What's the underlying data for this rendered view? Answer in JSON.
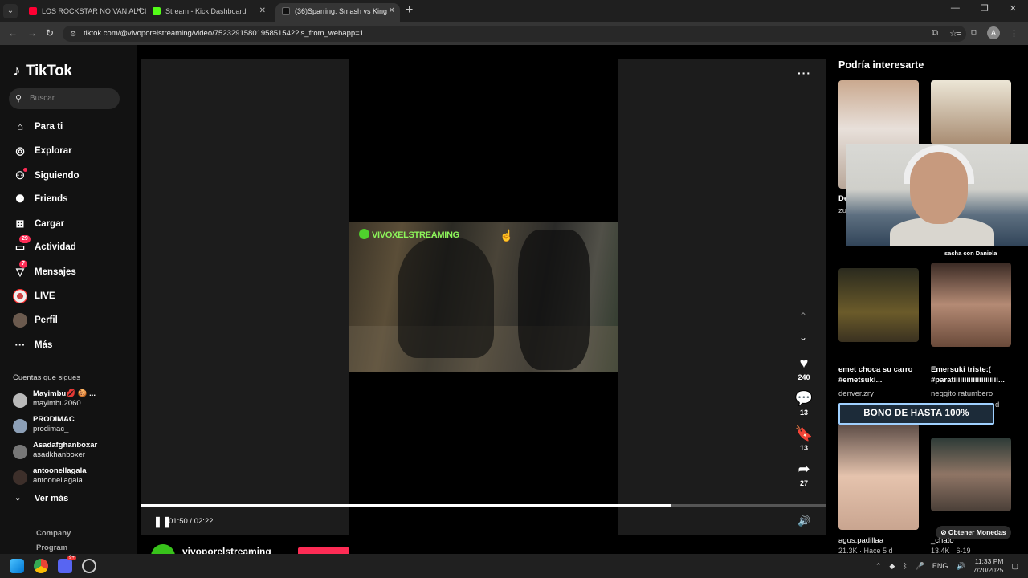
{
  "browser": {
    "tabs": [
      {
        "title": "LOS ROCKSTAR NO VAN AL CIE",
        "favicon_color": "#ff0033",
        "active": false
      },
      {
        "title": "Stream - Kick Dashboard",
        "favicon_color": "#53fc18",
        "active": false
      },
      {
        "title": "(36)Sparring: Smash vs King",
        "favicon_color": "#111111",
        "active": true
      }
    ],
    "url": "tiktok.com/@vivoporelstreaming/video/7523291580195851542?is_from_webapp=1",
    "profile_initial": "A"
  },
  "sidebar": {
    "logo": "TikTok",
    "search_placeholder": "Buscar",
    "nav": [
      {
        "label": "Para ti",
        "icon": "home-icon",
        "glyph": "⌂"
      },
      {
        "label": "Explorar",
        "icon": "compass-icon",
        "glyph": "⊘"
      },
      {
        "label": "Siguiendo",
        "icon": "following-icon",
        "glyph": "⚇"
      },
      {
        "label": "Friends",
        "icon": "friends-icon",
        "glyph": "⚉"
      },
      {
        "label": "Cargar",
        "icon": "upload-icon",
        "glyph": "⊞"
      },
      {
        "label": "Actividad",
        "icon": "activity-icon",
        "glyph": "▭",
        "badge": "29"
      },
      {
        "label": "Mensajes",
        "icon": "messages-icon",
        "glyph": "▽",
        "badge": "7"
      },
      {
        "label": "LIVE",
        "icon": "live-icon",
        "glyph": ""
      },
      {
        "label": "Perfil",
        "icon": "profile-icon",
        "glyph": ""
      },
      {
        "label": "Más",
        "icon": "more-icon",
        "glyph": "···"
      }
    ],
    "following_title": "Cuentas que sigues",
    "following": [
      {
        "name": "Mayimbu💋 🍪 ...",
        "handle": "mayimbu2060"
      },
      {
        "name": "PRODIMAC",
        "handle": "prodimac_"
      },
      {
        "name": "Asadafghanboxar",
        "handle": "asadkhanboxer"
      },
      {
        "name": "antoonellagala",
        "handle": "antoonellagala"
      }
    ],
    "see_more": "Ver más",
    "footer": [
      "Company",
      "Program"
    ]
  },
  "video": {
    "watermark": "VIVOXELSTREAMING",
    "time": "01:50 / 02:22",
    "progress": 0.7746,
    "author": "vivoporelstreaming",
    "likes": "240",
    "comments": "13",
    "saves": "13",
    "shares": "27"
  },
  "suggestions": {
    "title": "Podría interesarte",
    "items": [
      {
        "caption": "emet choca su carro #emetsuki...",
        "user": "denver.zry"
      },
      {
        "caption": "Emersuki triste:( #paratiiiiiiiiiiiiiiiiiiiii...",
        "user": "neggito.ratumbero"
      },
      {
        "user": "agus.padillaa",
        "meta": "21.3K · Hace 5 d"
      },
      {
        "user": "_chato",
        "meta": "13.4K · 6-19"
      }
    ],
    "partial_1": "De",
    "partial_2": "zu",
    "partial_3": "d"
  },
  "overlays": {
    "cam_label": "sacha con Daniela",
    "bono": "BONO DE HASTA 100%",
    "coins": "Obtener Monedas"
  },
  "taskbar": {
    "lang": "ENG",
    "time": "11:33 PM",
    "date": "7/20/2025",
    "discord_badge": "9+"
  }
}
